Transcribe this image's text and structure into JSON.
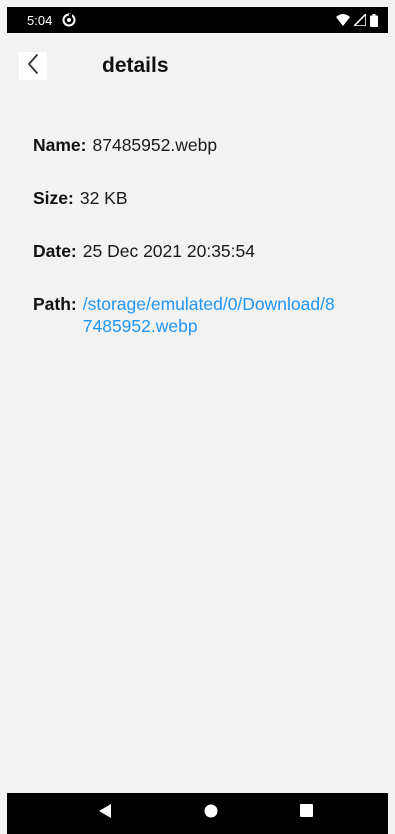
{
  "status_bar": {
    "time": "5:04"
  },
  "app_bar": {
    "title": "details",
    "back_icon": "chevron-left-icon"
  },
  "details": [
    {
      "label": "Name:",
      "value": "87485952.webp"
    },
    {
      "label": "Size:",
      "value": "32 KB"
    },
    {
      "label": "Date:",
      "value": "25 Dec 2021 20:35:54"
    },
    {
      "label": "Path:",
      "value": "/storage/emulated/0/Download/87485952.webp"
    }
  ],
  "colors": {
    "link": "#2196f3",
    "background": "#f2f2f2",
    "bars": "#000000"
  },
  "nav_bar": {
    "back_icon": "triangle-back-icon",
    "home_icon": "circle-home-icon",
    "recents_icon": "square-recents-icon"
  }
}
